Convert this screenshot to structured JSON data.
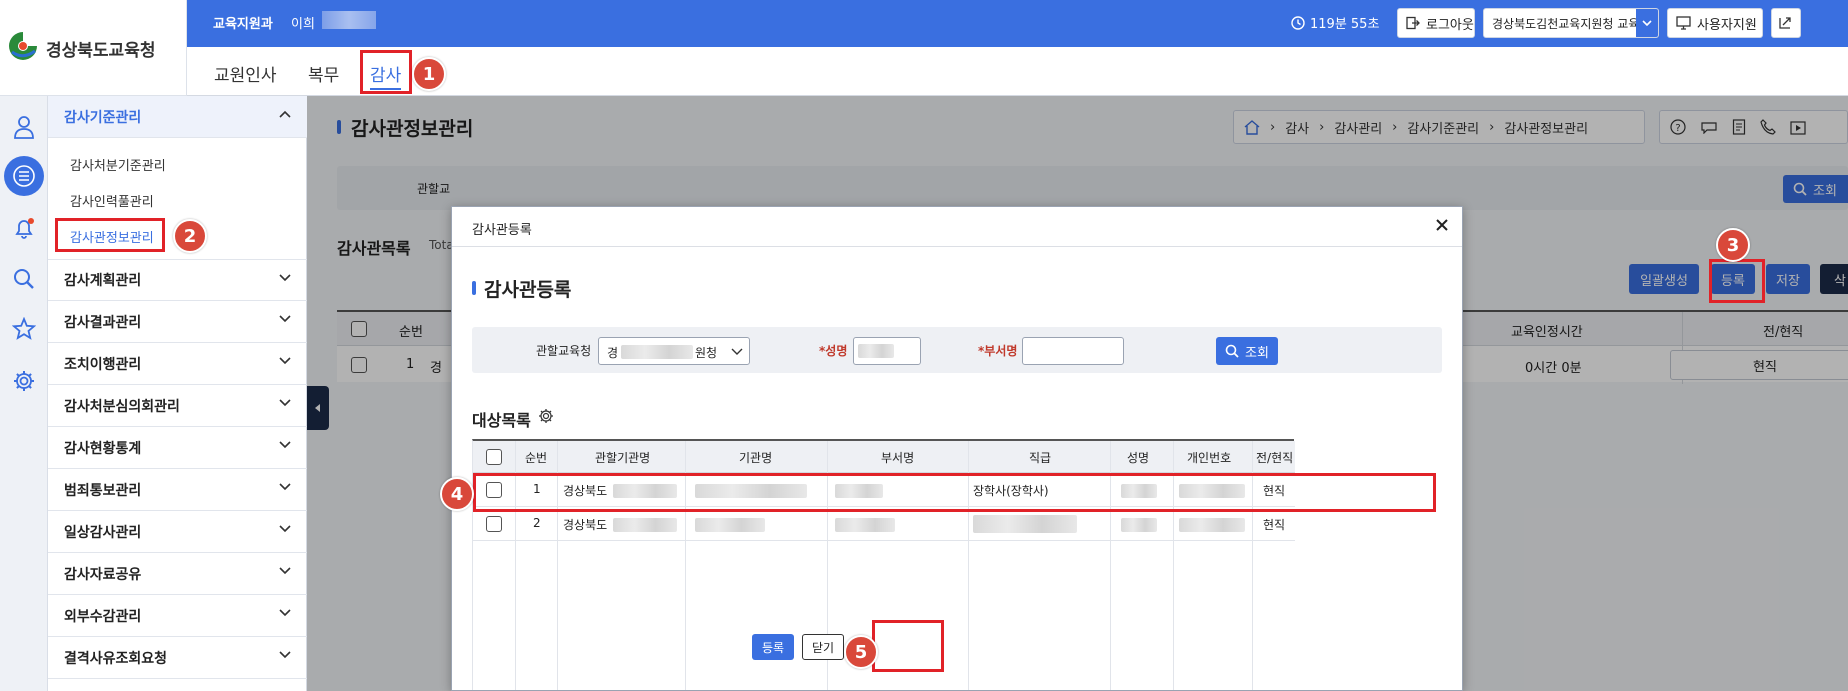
{
  "header": {
    "logo_text": "경상북도교육청",
    "department": "교육지원과",
    "user_name": "이희",
    "session_timer": "119분 55초",
    "logout_label": "로그아웃",
    "org_select_value": "경상북도김천교육지원청 교육지",
    "user_support_label": "사용자지원"
  },
  "tabs": [
    {
      "label": "교원인사"
    },
    {
      "label": "복무"
    },
    {
      "label": "감사"
    }
  ],
  "rail_icons": [
    "user-icon",
    "list-icon",
    "bell-icon",
    "search-icon",
    "star-icon",
    "gear-icon"
  ],
  "menu": {
    "section_title": "감사기준관리",
    "sub_items": [
      {
        "label": "감사처분기준관리"
      },
      {
        "label": "감사인력풀관리"
      },
      {
        "label": "감사관정보관리"
      }
    ],
    "groups": [
      {
        "label": "감사계획관리"
      },
      {
        "label": "감사결과관리"
      },
      {
        "label": "조치이행관리"
      },
      {
        "label": "감사처분심의회관리"
      },
      {
        "label": "감사현황통계"
      },
      {
        "label": "범죄통보관리"
      },
      {
        "label": "일상감사관리"
      },
      {
        "label": "감사자료공유"
      },
      {
        "label": "외부수감관리"
      },
      {
        "label": "결격사유조회요청"
      }
    ]
  },
  "page": {
    "title": "감사관정보관리",
    "breadcrumb": [
      "감사",
      "감사관리",
      "감사기준관리",
      "감사관정보관리"
    ],
    "search_label_partial": "관할교",
    "search_button": "조회",
    "list_title": "감사관목록",
    "total_partial": "Tota",
    "buttons": {
      "bulk": "일괄생성",
      "register": "등록",
      "save": "저장",
      "extra": "삭"
    },
    "table_headers": {
      "no": "순번",
      "edu_time": "교육인정시간",
      "status": "전/현직"
    },
    "row": {
      "no": "1",
      "partial": "경",
      "edu_time": "0시간 0분",
      "status": "현직"
    }
  },
  "modal": {
    "window_title": "감사관등록",
    "heading": "감사관등록",
    "search": {
      "office_label": "관할교육청",
      "office_value_start": "경",
      "office_value_end": "원청",
      "name_label": "*성명",
      "dept_label": "*부서명",
      "search_button": "조회"
    },
    "list_title": "대상목록",
    "columns": [
      "순번",
      "관할기관명",
      "기관명",
      "부서명",
      "직급",
      "성명",
      "개인번호",
      "전/현직"
    ],
    "rows": [
      {
        "no": "1",
        "office": "경상북도",
        "rank": "장학사(장학사)",
        "status": "현직"
      },
      {
        "no": "2",
        "office": "경상북도",
        "rank": "",
        "status": "현직"
      }
    ],
    "register_button": "등록",
    "close_button": "닫기"
  },
  "annotations": [
    "1",
    "2",
    "3",
    "4",
    "5"
  ],
  "colors": {
    "primary": "#3a6fe0",
    "navy": "#1c2b4a",
    "annotation_red": "#e12228",
    "badge": "#d9483a"
  }
}
